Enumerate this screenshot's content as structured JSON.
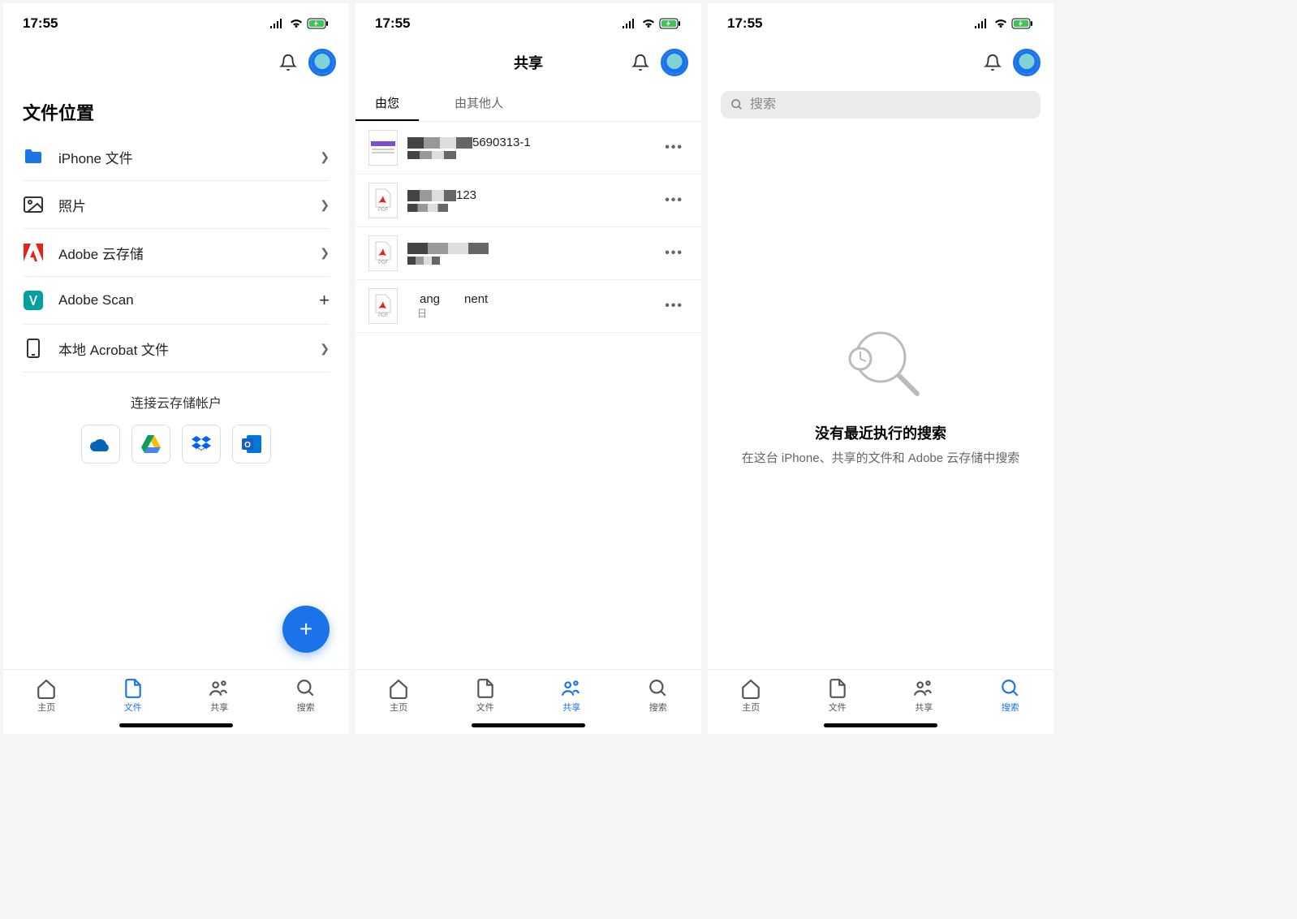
{
  "status": {
    "time": "17:55"
  },
  "screen1": {
    "title": "文件位置",
    "items": [
      {
        "label": "iPhone 文件",
        "icon": "folder",
        "action": "chevron"
      },
      {
        "label": "照片",
        "icon": "photo",
        "action": "chevron"
      },
      {
        "label": "Adobe 云存储",
        "icon": "adobe",
        "action": "chevron"
      },
      {
        "label": "Adobe Scan",
        "icon": "scan",
        "action": "plus"
      },
      {
        "label": "本地 Acrobat 文件",
        "icon": "phone",
        "action": "chevron"
      }
    ],
    "connect_label": "连接云存储帐户",
    "cloud_services": [
      "onedrive",
      "gdrive",
      "dropbox",
      "onenote"
    ]
  },
  "screen2": {
    "header_title": "共享",
    "tabs": [
      {
        "label": "由您",
        "active": true
      },
      {
        "label": "由其他人",
        "active": false
      }
    ],
    "docs": [
      {
        "name_suffix": "5690313-1",
        "thumb": "doc"
      },
      {
        "name_suffix": "123",
        "thumb": "pdf"
      },
      {
        "name_suffix": "",
        "thumb": "pdf"
      },
      {
        "name_suffix": "nent",
        "meta_suffix": "日",
        "name_mid": "ang",
        "thumb": "pdf"
      }
    ]
  },
  "screen3": {
    "search_placeholder": "搜索",
    "empty_title": "没有最近执行的搜索",
    "empty_sub": "在这台 iPhone、共享的文件和 Adobe 云存储中搜索"
  },
  "tabs": {
    "home": "主页",
    "files": "文件",
    "share": "共享",
    "search": "搜索"
  }
}
